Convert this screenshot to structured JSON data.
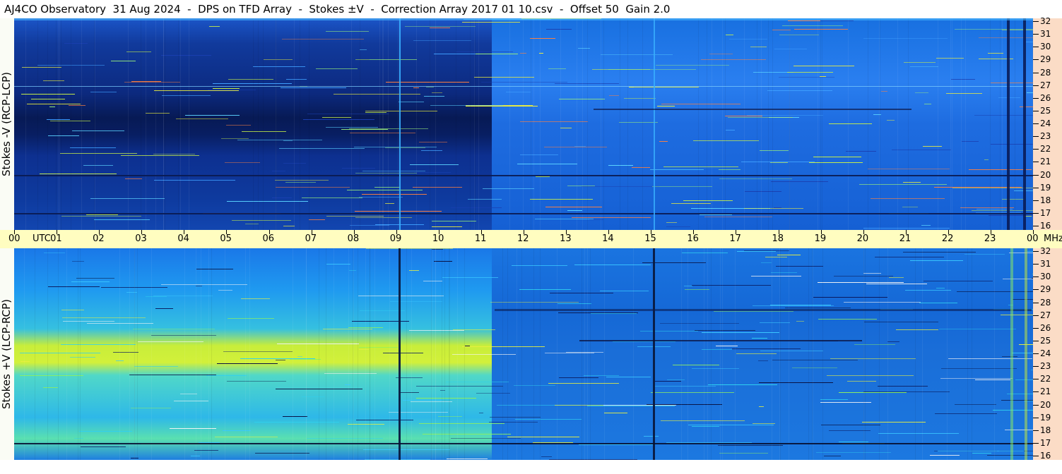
{
  "title": "AJ4CO Observatory  31 Aug 2024  -  DPS on TFD Array  -  Stokes ±V  -  Correction Array 2017 01 10.csv  -  Offset 50  Gain 2.0",
  "panels": [
    {
      "id": "top",
      "label": "Stokes -V (RCP-LCP)"
    },
    {
      "id": "bottom",
      "label": "Stokes +V (LCP-RCP)"
    }
  ],
  "freq_labels": [
    "32",
    "31",
    "30",
    "29",
    "28",
    "27",
    "26",
    "25",
    "24",
    "23",
    "22",
    "21",
    "20",
    "19",
    "18",
    "17",
    "16"
  ],
  "time_labels": [
    "00",
    "UTC",
    "01",
    "02",
    "03",
    "04",
    "05",
    "06",
    "07",
    "08",
    "09",
    "10",
    "11",
    "12",
    "13",
    "14",
    "15",
    "16",
    "17",
    "18",
    "19",
    "20",
    "21",
    "22",
    "23",
    "00"
  ],
  "freq_unit": "MHz",
  "colors": {
    "scale_bg": "#fbdcc6",
    "axis_bg": "#fffdc0"
  }
}
